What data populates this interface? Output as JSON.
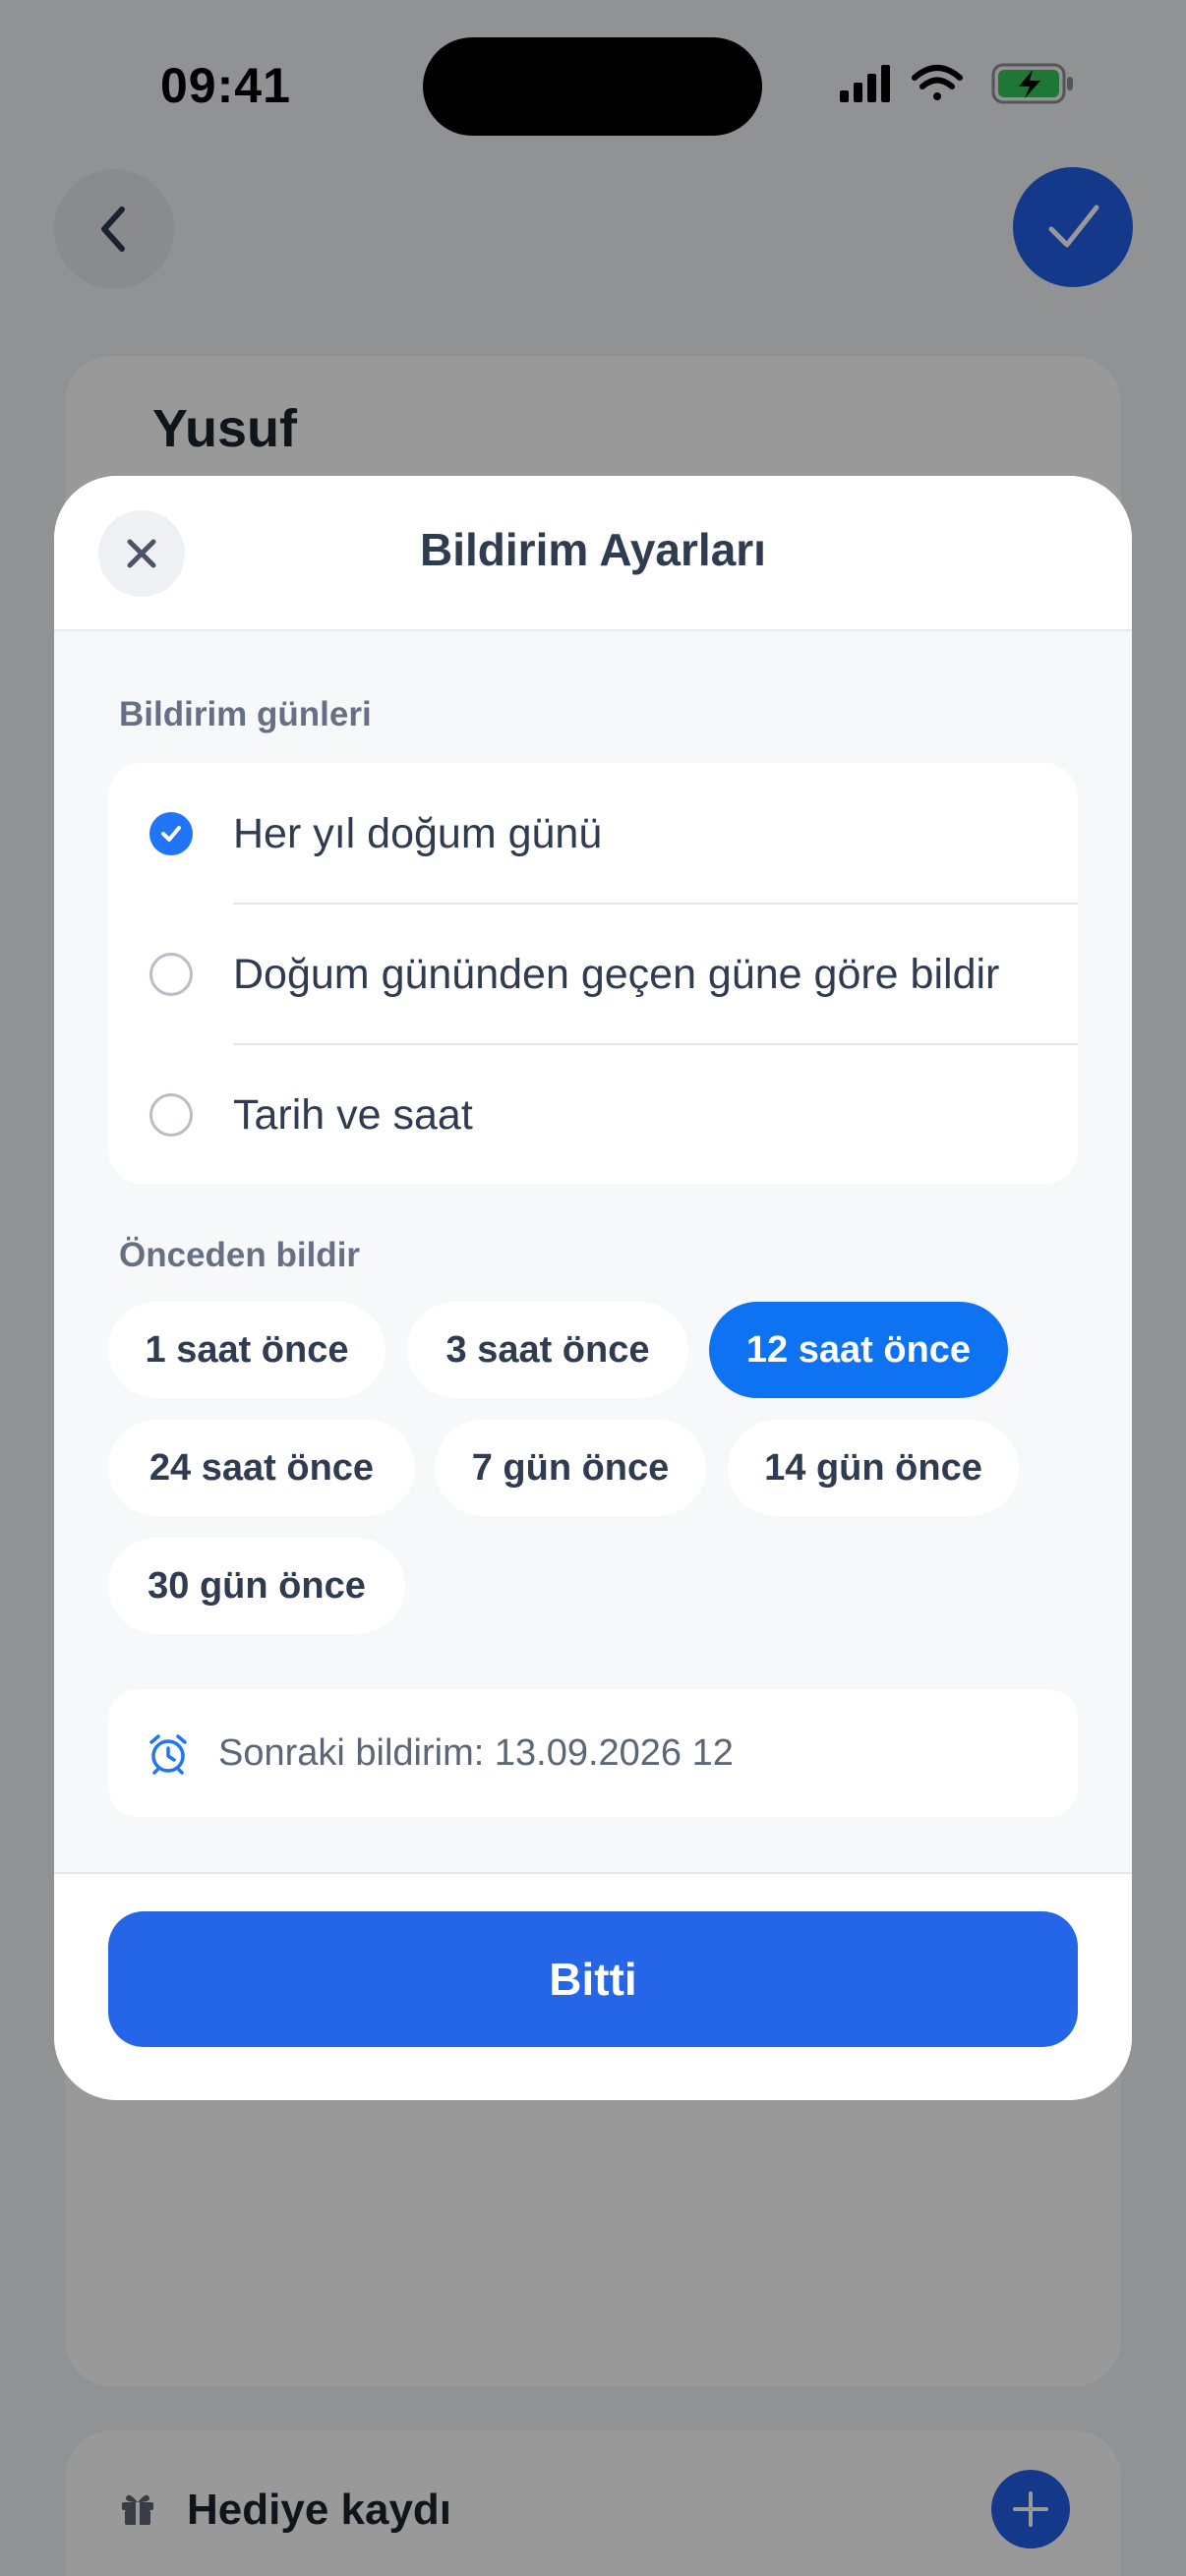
{
  "status_bar": {
    "time": "09:41"
  },
  "background": {
    "contact_name": "Yusuf",
    "gift_section_label": "Hediye kaydı",
    "icons": {
      "back": "chevron-left-icon",
      "confirm": "checkmark-icon",
      "gift": "gift-icon",
      "add": "plus-icon"
    }
  },
  "modal": {
    "title": "Bildirim Ayarları",
    "close_icon": "close-icon",
    "days_section": {
      "label": "Bildirim günleri",
      "options": [
        {
          "label": "Her yıl doğum günü",
          "selected": true
        },
        {
          "label": "Doğum gününden geçen güne göre bildir",
          "selected": false
        },
        {
          "label": "Tarih ve saat",
          "selected": false
        }
      ]
    },
    "advance_section": {
      "label": "Önceden bildir",
      "chips": [
        {
          "label": "1 saat önce",
          "selected": false
        },
        {
          "label": "3 saat önce",
          "selected": false
        },
        {
          "label": "12 saat önce",
          "selected": true
        },
        {
          "label": "24 saat önce",
          "selected": false
        },
        {
          "label": "7 gün önce",
          "selected": false
        },
        {
          "label": "14 gün önce",
          "selected": false
        },
        {
          "label": "30 gün önce",
          "selected": false
        }
      ]
    },
    "next_notification": {
      "icon": "alarm-clock-icon",
      "text": "Sonraki bildirim: 13.09.2026 12"
    },
    "done_button": "Bitti"
  },
  "colors": {
    "accent": "#0d73f2",
    "primary_button": "#2566e8",
    "radio_checked": "#1f75f5",
    "scrim": "rgba(0,0,0,0.40)"
  }
}
